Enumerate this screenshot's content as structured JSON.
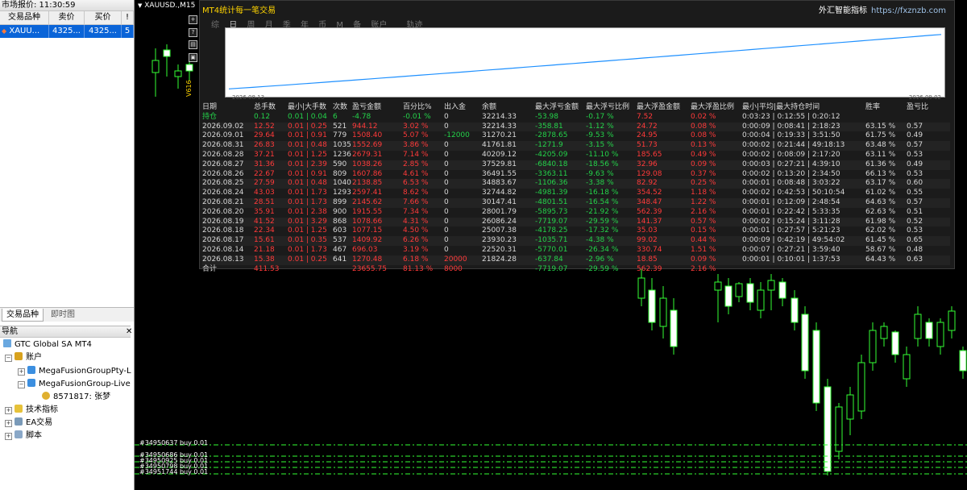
{
  "market_watch": {
    "title": "市场报价: 11:30:59",
    "headers": [
      "交易品种",
      "卖价",
      "买价",
      "!"
    ],
    "rows": [
      {
        "symbol": "XAUU...",
        "bid": "4325...",
        "ask": "4325...",
        "spread": "5"
      }
    ],
    "tabs": [
      "交易品种",
      "即时图"
    ]
  },
  "navigator": {
    "title": "导航",
    "broker": "GTC Global SA MT4",
    "accounts_label": "账户",
    "account_items": [
      "MegaFusionGroupPty-L",
      "MegaFusionGroup-Live"
    ],
    "login": "8571817: 张梦",
    "sections": [
      "技术指标",
      "EA交易",
      "脚本"
    ]
  },
  "chart": {
    "symbol_title": "XAUUSD.,M15",
    "axis_label": "V616",
    "toolbar_icons": [
      "plus-icon",
      "question-icon",
      "chart-icon",
      "window-icon"
    ]
  },
  "panel": {
    "title": "MT4统计每一笔交易",
    "site_name": "外汇智能指标",
    "site_url": "https://fxznzb.com",
    "tabs": [
      "综",
      "日",
      "周",
      "月",
      "季",
      "年",
      "币",
      "M",
      "备",
      "账户",
      "轨迹"
    ],
    "active_tab": "日",
    "equity_curve": {
      "start_date": "2026.08.13",
      "end_date": "2026.09.02",
      "color": "#1e90ff"
    },
    "columns": [
      "日期",
      "总手数",
      "最小|大手数",
      "次数",
      "盈亏金额",
      "百分比%",
      "出入金",
      "余额",
      "最大浮亏金额",
      "最大浮亏比例",
      "最大浮盈金额",
      "最大浮盈比例",
      "最小|平均|最大持仓时间",
      "胜率",
      "盈亏比"
    ],
    "rows": [
      {
        "date": "持仓",
        "lots": "0.12",
        "minmax": "0.01 | 0.04",
        "count": "6",
        "pl": "-4.78",
        "pct": "-0.01 %",
        "dep": "0",
        "bal": "32214.33",
        "maxfl": "-53.98",
        "maxflp": "-0.17 %",
        "maxfp": "7.52",
        "maxfpp": "0.02 %",
        "time": "0:03:23 | 0:12:55 | 0:20:12",
        "win": "",
        "ratio": "",
        "color": "grn"
      },
      {
        "date": "2026.09.02",
        "lots": "12.52",
        "minmax": "0.01 | 0.25",
        "count": "521",
        "pl": "944.12",
        "pct": "3.02 %",
        "dep": "0",
        "bal": "32214.33",
        "maxfl": "-358.81",
        "maxflp": "-1.12 %",
        "maxfp": "24.72",
        "maxfpp": "0.08 %",
        "time": "0:00:09 | 0:08:41 | 2:18:23",
        "win": "63.15 %",
        "ratio": "0.57",
        "color": "red"
      },
      {
        "date": "2026.09.01",
        "lots": "29.64",
        "minmax": "0.01 | 0.91",
        "count": "779",
        "pl": "1508.40",
        "pct": "5.07 %",
        "dep": "-12000",
        "bal": "31270.21",
        "maxfl": "-2878.65",
        "maxflp": "-9.53 %",
        "maxfp": "24.95",
        "maxfpp": "0.08 %",
        "time": "0:00:04 | 0:19:33 | 3:51:50",
        "win": "61.75 %",
        "ratio": "0.49",
        "color": "red"
      },
      {
        "date": "2026.08.31",
        "lots": "26.83",
        "minmax": "0.01 | 0.48",
        "count": "1035",
        "pl": "1552.69",
        "pct": "3.86 %",
        "dep": "0",
        "bal": "41761.81",
        "maxfl": "-1271.9",
        "maxflp": "-3.15 %",
        "maxfp": "51.73",
        "maxfpp": "0.13 %",
        "time": "0:00:02 | 0:21:44 | 49:18:13",
        "win": "63.48 %",
        "ratio": "0.57",
        "color": "red"
      },
      {
        "date": "2026.08.28",
        "lots": "37.21",
        "minmax": "0.01 | 1.25",
        "count": "1236",
        "pl": "2679.31",
        "pct": "7.14 %",
        "dep": "0",
        "bal": "40209.12",
        "maxfl": "-4205.09",
        "maxflp": "-11.10 %",
        "maxfp": "185.65",
        "maxfpp": "0.49 %",
        "time": "0:00:02 | 0:08:09 | 2:17:20",
        "win": "63.11 %",
        "ratio": "0.53",
        "color": "red"
      },
      {
        "date": "2026.08.27",
        "lots": "31.36",
        "minmax": "0.01 | 2.39",
        "count": "590",
        "pl": "1038.26",
        "pct": "2.85 %",
        "dep": "0",
        "bal": "37529.81",
        "maxfl": "-6840.18",
        "maxflp": "-18.56 %",
        "maxfp": "32.96",
        "maxfpp": "0.09 %",
        "time": "0:00:03 | 0:27:21 | 4:39:10",
        "win": "61.36 %",
        "ratio": "0.49",
        "color": "red"
      },
      {
        "date": "2026.08.26",
        "lots": "22.67",
        "minmax": "0.01 | 0.91",
        "count": "809",
        "pl": "1607.86",
        "pct": "4.61 %",
        "dep": "0",
        "bal": "36491.55",
        "maxfl": "-3363.11",
        "maxflp": "-9.63 %",
        "maxfp": "129.08",
        "maxfpp": "0.37 %",
        "time": "0:00:02 | 0:13:20 | 2:34:50",
        "win": "66.13 %",
        "ratio": "0.53",
        "color": "red"
      },
      {
        "date": "2026.08.25",
        "lots": "27.59",
        "minmax": "0.01 | 0.48",
        "count": "1040",
        "pl": "2138.85",
        "pct": "6.53 %",
        "dep": "0",
        "bal": "34883.67",
        "maxfl": "-1106.36",
        "maxflp": "-3.38 %",
        "maxfp": "82.92",
        "maxfpp": "0.25 %",
        "time": "0:00:01 | 0:08:48 | 3:03:22",
        "win": "63.17 %",
        "ratio": "0.60",
        "color": "red"
      },
      {
        "date": "2026.08.24",
        "lots": "43.03",
        "minmax": "0.01 | 1.73",
        "count": "1293",
        "pl": "2597.41",
        "pct": "8.62 %",
        "dep": "0",
        "bal": "32744.82",
        "maxfl": "-4981.39",
        "maxflp": "-16.18 %",
        "maxfp": "354.52",
        "maxfpp": "1.18 %",
        "time": "0:00:02 | 0:42:53 | 50:10:54",
        "win": "61.02 %",
        "ratio": "0.55",
        "color": "red"
      },
      {
        "date": "2026.08.21",
        "lots": "28.51",
        "minmax": "0.01 | 1.73",
        "count": "899",
        "pl": "2145.62",
        "pct": "7.66 %",
        "dep": "0",
        "bal": "30147.41",
        "maxfl": "-4801.51",
        "maxflp": "-16.54 %",
        "maxfp": "348.47",
        "maxfpp": "1.22 %",
        "time": "0:00:01 | 0:12:09 | 2:48:54",
        "win": "64.63 %",
        "ratio": "0.57",
        "color": "red"
      },
      {
        "date": "2026.08.20",
        "lots": "35.91",
        "minmax": "0.01 | 2.38",
        "count": "900",
        "pl": "1915.55",
        "pct": "7.34 %",
        "dep": "0",
        "bal": "28001.79",
        "maxfl": "-5895.73",
        "maxflp": "-21.92 %",
        "maxfp": "562.39",
        "maxfpp": "2.16 %",
        "time": "0:00:01 | 0:22:42 | 5:33:35",
        "win": "62.63 %",
        "ratio": "0.51",
        "color": "red"
      },
      {
        "date": "2026.08.19",
        "lots": "41.52",
        "minmax": "0.01 | 3.29",
        "count": "868",
        "pl": "1078.66",
        "pct": "4.31 %",
        "dep": "0",
        "bal": "26086.24",
        "maxfl": "-7719.07",
        "maxflp": "-29.59 %",
        "maxfp": "141.37",
        "maxfpp": "0.57 %",
        "time": "0:00:02 | 0:15:24 | 3:11:28",
        "win": "61.98 %",
        "ratio": "0.52",
        "color": "red"
      },
      {
        "date": "2026.08.18",
        "lots": "22.34",
        "minmax": "0.01 | 1.25",
        "count": "603",
        "pl": "1077.15",
        "pct": "4.50 %",
        "dep": "0",
        "bal": "25007.38",
        "maxfl": "-4178.25",
        "maxflp": "-17.32 %",
        "maxfp": "35.03",
        "maxfpp": "0.15 %",
        "time": "0:00:01 | 0:27:57 | 5:21:23",
        "win": "62.02 %",
        "ratio": "0.53",
        "color": "red"
      },
      {
        "date": "2026.08.17",
        "lots": "15.61",
        "minmax": "0.01 | 0.35",
        "count": "537",
        "pl": "1409.92",
        "pct": "6.26 %",
        "dep": "0",
        "bal": "23930.23",
        "maxfl": "-1035.71",
        "maxflp": "-4.38 %",
        "maxfp": "99.02",
        "maxfpp": "0.44 %",
        "time": "0:00:09 | 0:42:19 | 49:54:02",
        "win": "61.45 %",
        "ratio": "0.65",
        "color": "red"
      },
      {
        "date": "2026.08.14",
        "lots": "21.18",
        "minmax": "0.01 | 1.73",
        "count": "467",
        "pl": "696.03",
        "pct": "3.19 %",
        "dep": "0",
        "bal": "22520.31",
        "maxfl": "-5770.01",
        "maxflp": "-26.34 %",
        "maxfp": "330.74",
        "maxfpp": "1.51 %",
        "time": "0:00:07 | 0:27:21 | 3:59:40",
        "win": "58.67 %",
        "ratio": "0.48",
        "color": "red"
      },
      {
        "date": "2026.08.13",
        "lots": "15.38",
        "minmax": "0.01 | 0.25",
        "count": "641",
        "pl": "1270.48",
        "pct": "6.18 %",
        "dep": "20000",
        "bal": "21824.28",
        "maxfl": "-637.84",
        "maxflp": "-2.96 %",
        "maxfp": "18.85",
        "maxfpp": "0.09 %",
        "time": "0:00:01 | 0:10:01 | 1:37:53",
        "win": "64.43 %",
        "ratio": "0.63",
        "color": "red"
      },
      {
        "date": "合计",
        "lots": "411.53",
        "minmax": "",
        "count": "",
        "pl": "23655.75",
        "pct": "81.13 %",
        "dep": "8000",
        "bal": "",
        "maxfl": "-7719.07",
        "maxflp": "-29.59 %",
        "maxfp": "562.39",
        "maxfpp": "2.16 %",
        "time": "",
        "win": "",
        "ratio": "",
        "color": "red"
      }
    ]
  },
  "trade_labels": [
    "#34950637 buy 0.01",
    "#34950686 buy 0.01",
    "#34950925 buy 0.01",
    "#34950798 buy 0.01",
    "#34951744 buy 0.01"
  ]
}
